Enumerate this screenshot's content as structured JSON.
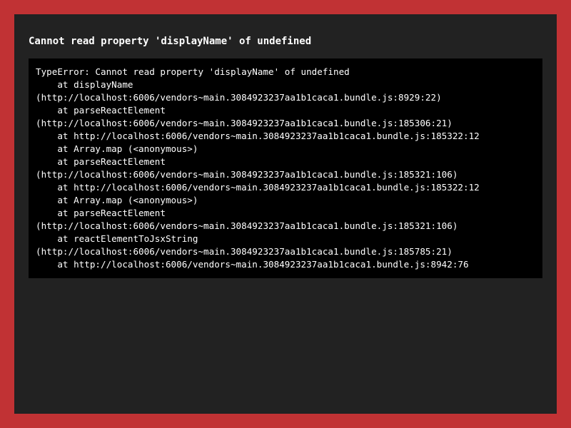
{
  "colors": {
    "outer_border": "#c13234",
    "panel_background": "#222222",
    "stack_background": "#000000",
    "text": "#ffffff"
  },
  "error": {
    "title": "Cannot read property 'displayName' of undefined",
    "stack_lines": [
      "TypeError: Cannot read property 'displayName' of undefined",
      "    at displayName",
      "(http://localhost:6006/vendors~main.3084923237aa1b1caca1.bundle.js:8929:22)",
      "    at parseReactElement",
      "(http://localhost:6006/vendors~main.3084923237aa1b1caca1.bundle.js:185306:21)",
      "    at http://localhost:6006/vendors~main.3084923237aa1b1caca1.bundle.js:185322:12",
      "    at Array.map (<anonymous>)",
      "    at parseReactElement",
      "(http://localhost:6006/vendors~main.3084923237aa1b1caca1.bundle.js:185321:106)",
      "    at http://localhost:6006/vendors~main.3084923237aa1b1caca1.bundle.js:185322:12",
      "    at Array.map (<anonymous>)",
      "    at parseReactElement",
      "(http://localhost:6006/vendors~main.3084923237aa1b1caca1.bundle.js:185321:106)",
      "    at reactElementToJsxString",
      "(http://localhost:6006/vendors~main.3084923237aa1b1caca1.bundle.js:185785:21)",
      "    at http://localhost:6006/vendors~main.3084923237aa1b1caca1.bundle.js:8942:76"
    ]
  }
}
